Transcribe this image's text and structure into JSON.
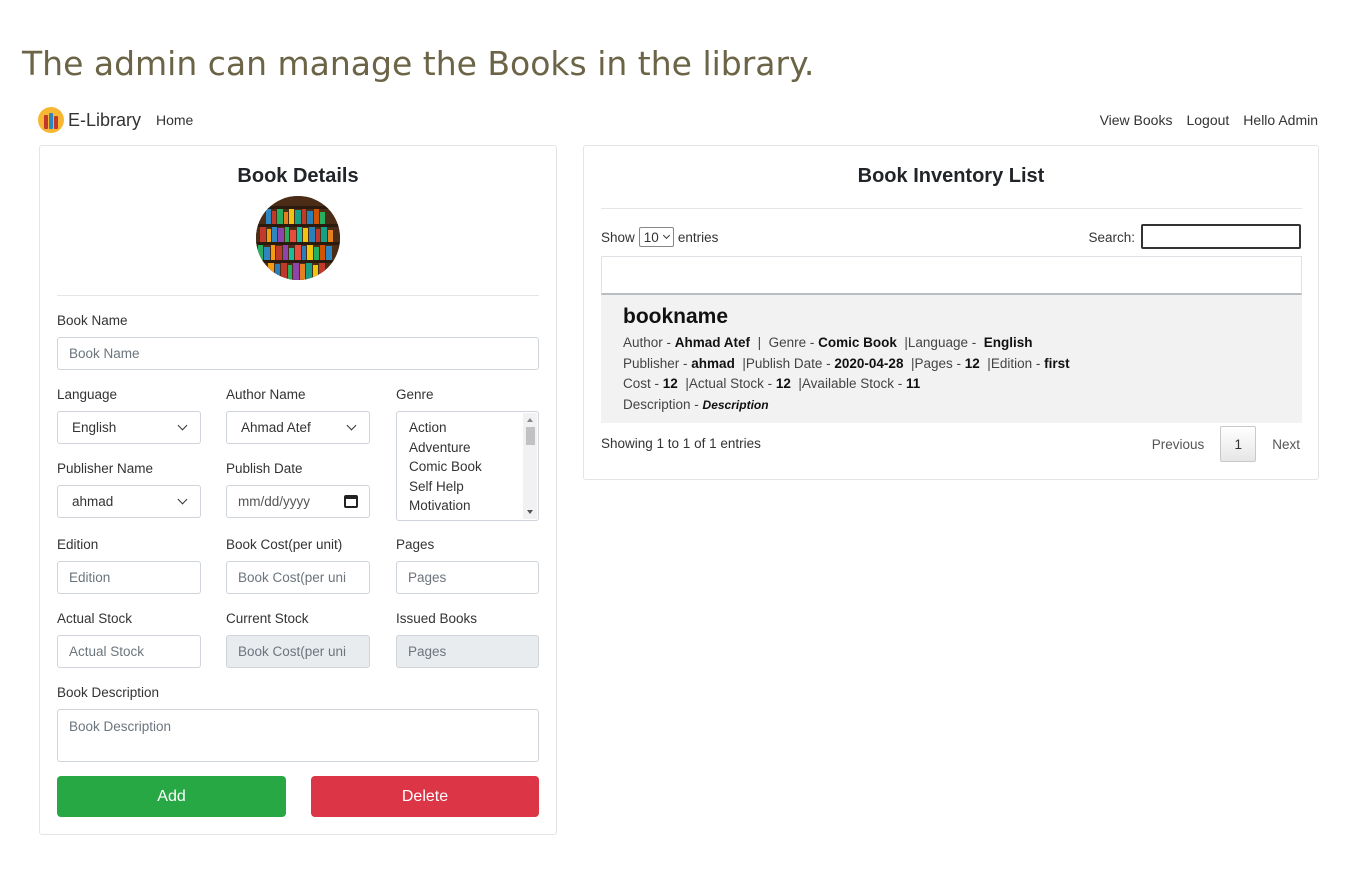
{
  "caption": "The admin can manage the Books in the library.",
  "navbar": {
    "brand": "E-Library",
    "home": "Home",
    "links": [
      "View Books",
      "Logout",
      "Hello Admin"
    ]
  },
  "form": {
    "title": "Book Details",
    "book_name": {
      "label": "Book Name",
      "placeholder": "Book Name"
    },
    "language": {
      "label": "Language",
      "value": "English"
    },
    "author": {
      "label": "Author Name",
      "value": "Ahmad Atef"
    },
    "genre": {
      "label": "Genre",
      "options": [
        "Action",
        "Adventure",
        "Comic Book",
        "Self Help",
        "Motivation"
      ]
    },
    "publisher": {
      "label": "Publisher Name",
      "value": "ahmad"
    },
    "publish_date": {
      "label": "Publish Date",
      "placeholder": "mm/dd/yyyy"
    },
    "edition": {
      "label": "Edition",
      "placeholder": "Edition"
    },
    "cost": {
      "label": "Book Cost(per unit)",
      "placeholder": "Book Cost(per uni"
    },
    "pages": {
      "label": "Pages",
      "placeholder": "Pages"
    },
    "actual_stock": {
      "label": "Actual Stock",
      "placeholder": "Actual Stock"
    },
    "current_stock": {
      "label": "Current Stock",
      "placeholder": "Book Cost(per uni"
    },
    "issued_books": {
      "label": "Issued Books",
      "placeholder": "Pages"
    },
    "description": {
      "label": "Book Description",
      "placeholder": "Book Description"
    },
    "add_label": "Add",
    "delete_label": "Delete"
  },
  "inventory": {
    "title": "Book Inventory List",
    "show_prefix": "Show",
    "page_size": "10",
    "show_suffix": "entries",
    "search_label": "Search:",
    "book": {
      "name": "bookname",
      "author_label": "Author -",
      "author": "Ahmad Atef",
      "genre_label": "Genre -",
      "genre": "Comic Book",
      "language_label": "Language -",
      "language": "English",
      "publisher_label": "Publisher -",
      "publisher": "ahmad",
      "publish_date_label": "Publish Date -",
      "publish_date": "2020-04-28",
      "pages_label": "Pages -",
      "pages": "12",
      "edition_label": "Edition -",
      "edition": "first",
      "cost_label": "Cost -",
      "cost": "12",
      "actual_stock_label": "Actual Stock -",
      "actual_stock": "12",
      "available_stock_label": "Available Stock -",
      "available_stock": "11",
      "description_label": "Description -",
      "description": "Description"
    },
    "info": "Showing 1 to 1 of 1 entries",
    "previous": "Previous",
    "page": "1",
    "next": "Next"
  },
  "colors": {
    "add": "#28a745",
    "delete": "#dc3545",
    "caption": "#6b6446"
  }
}
